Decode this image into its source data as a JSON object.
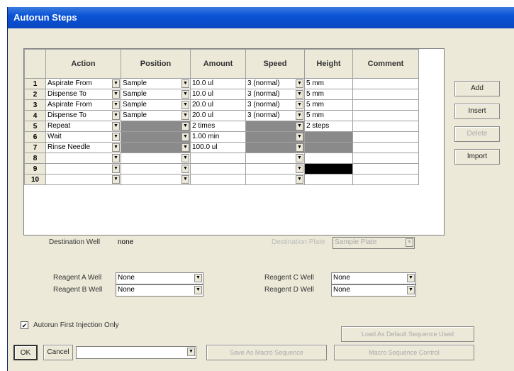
{
  "window": {
    "title": "Autorun Steps"
  },
  "grid": {
    "headers": [
      "Action",
      "Position",
      "Amount",
      "Speed",
      "Height",
      "Comment"
    ],
    "rows": [
      {
        "n": "1",
        "action": "Aspirate From",
        "position": "Sample",
        "amount": "10.0 ul",
        "speed": "3 (normal)",
        "height": "5 mm",
        "comment": ""
      },
      {
        "n": "2",
        "action": "Dispense To",
        "position": "Sample",
        "amount": "10.0 ul",
        "speed": "3 (normal)",
        "height": "5 mm",
        "comment": ""
      },
      {
        "n": "3",
        "action": "Aspirate From",
        "position": "Sample",
        "amount": "20.0 ul",
        "speed": "3 (normal)",
        "height": "5 mm",
        "comment": ""
      },
      {
        "n": "4",
        "action": "Dispense To",
        "position": "Sample",
        "amount": "20.0 ul",
        "speed": "3 (normal)",
        "height": "5 mm",
        "comment": ""
      },
      {
        "n": "5",
        "action": "Repeat",
        "position": "",
        "amount": "2 times",
        "speed": "",
        "height": "2 steps",
        "comment": ""
      },
      {
        "n": "6",
        "action": "Wait",
        "position": "",
        "amount": "1.00 min",
        "speed": "",
        "height": "",
        "comment": ""
      },
      {
        "n": "7",
        "action": "Rinse Needle",
        "position": "",
        "amount": "100.0 ul",
        "speed": "",
        "height": "",
        "comment": ""
      },
      {
        "n": "8",
        "action": "",
        "position": "",
        "amount": "",
        "speed": "",
        "height": "",
        "comment": ""
      },
      {
        "n": "9",
        "action": "",
        "position": "",
        "amount": "",
        "speed": "",
        "height": "",
        "comment": ""
      },
      {
        "n": "10",
        "action": "",
        "position": "",
        "amount": "",
        "speed": "",
        "height": "",
        "comment": ""
      }
    ]
  },
  "buttons": {
    "add": "Add",
    "insert": "Insert",
    "delete": "Delete",
    "import": "Import",
    "ok": "OK",
    "cancel": "Cancel",
    "disabled_a": "Save As Macro Sequence",
    "disabled_b": "Macro Sequence Control",
    "disabled_c": "Load As Default Sequence Used"
  },
  "destination": {
    "label": "Destination Well",
    "value": "none",
    "label2": "Destination Plate",
    "value2": "Sample Plate"
  },
  "reagents": {
    "a_label": "Reagent A Well",
    "a_value": "None",
    "b_label": "Reagent B Well",
    "b_value": "None",
    "c_label": "Reagent C Well",
    "c_value": "None",
    "d_label": "Reagent D Well",
    "d_value": "None"
  },
  "options": {
    "first_injection_label": "Autorun First Injection Only",
    "first_injection_checked": true,
    "checkmark": "✔"
  },
  "footer": {
    "combo_value": ""
  }
}
